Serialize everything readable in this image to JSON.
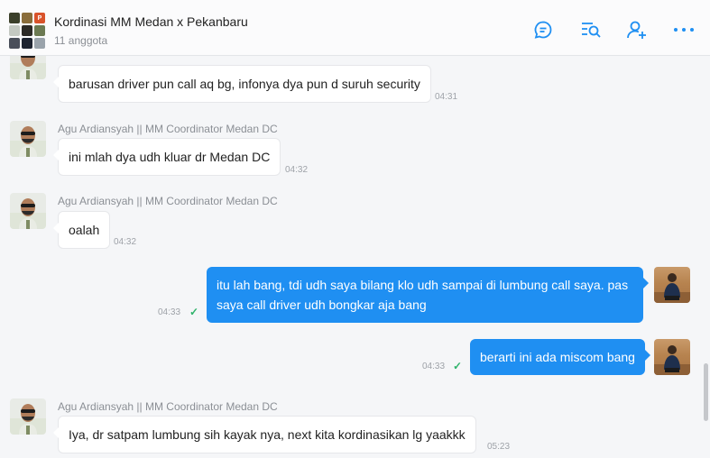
{
  "header": {
    "title": "Kordinasi MM Medan x Pekanbaru",
    "subtitle": "11 anggota",
    "group_avatar_letter": "P",
    "icons": [
      "chat-bubble-icon",
      "search-list-icon",
      "add-member-icon",
      "more-icon"
    ],
    "accent_color": "#1f8ff2"
  },
  "messages": [
    {
      "direction": "in",
      "text": "barusan driver pun call aq bg, infonya dya pun d suruh security",
      "time": "04:31"
    },
    {
      "direction": "in",
      "sender": "Agu Ardiansyah || MM Coordinator Medan DC",
      "text": "ini mlah dya udh kluar dr Medan DC",
      "time": "04:32"
    },
    {
      "direction": "in",
      "sender": "Agu Ardiansyah || MM Coordinator Medan DC",
      "text": "oalah",
      "time": "04:32"
    },
    {
      "direction": "out",
      "line1": "itu lah bang, tdi udh saya bilang klo udh sampai di lumbung call saya. pas",
      "line2": "saya call driver udh bongkar aja bang",
      "time": "04:33",
      "read": true
    },
    {
      "direction": "out",
      "text": "berarti ini ada miscom bang",
      "time": "04:33",
      "read": true
    },
    {
      "direction": "in",
      "sender": "Agu Ardiansyah || MM Coordinator Medan DC",
      "text": "Iya,  dr satpam lumbung sih kayak nya,  next kita kordinasikan lg yaakkk",
      "time": "05:23"
    }
  ]
}
